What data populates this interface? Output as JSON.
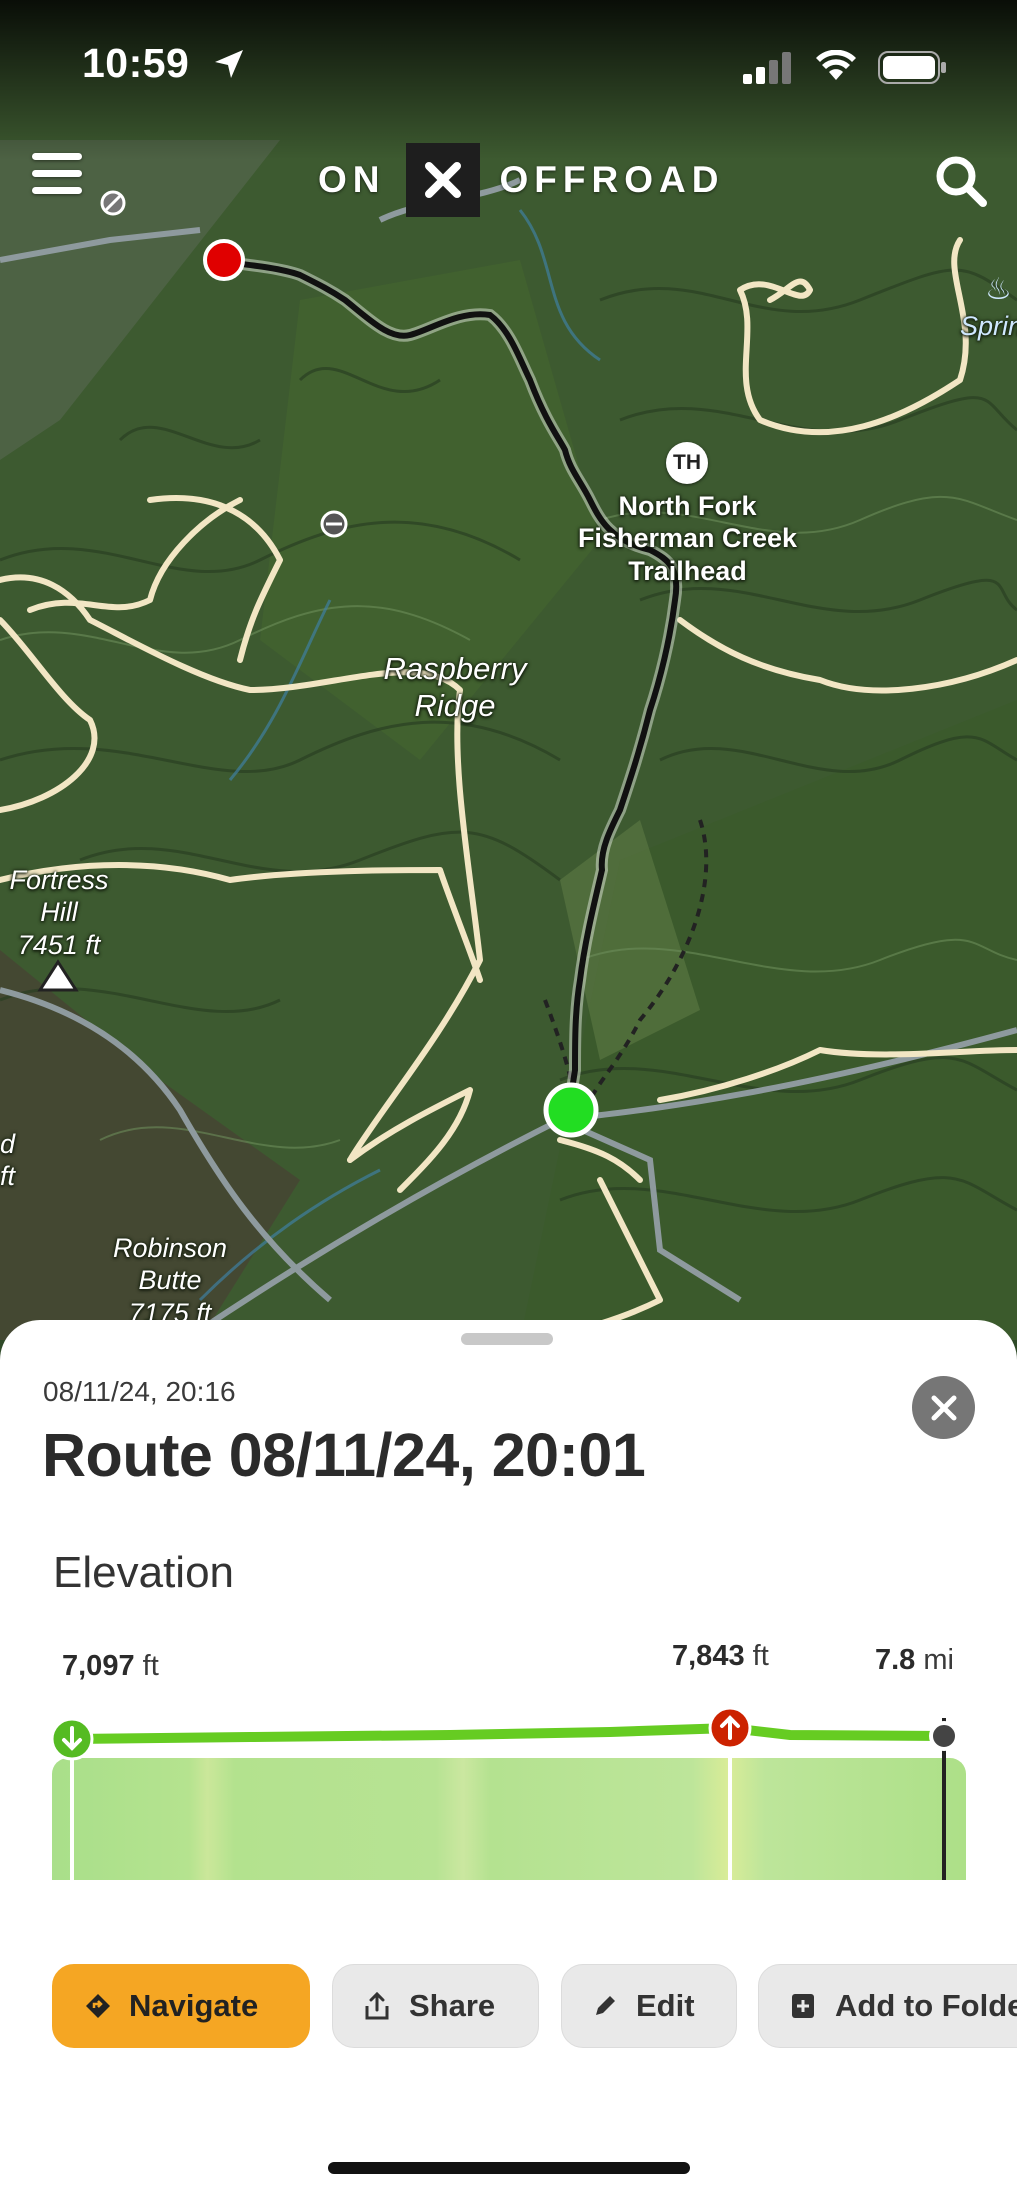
{
  "status_bar": {
    "time": "10:59",
    "icons": [
      "location-arrow-icon",
      "cellular-signal-icon",
      "wifi-icon",
      "battery-icon"
    ]
  },
  "header": {
    "logo_left": "ON",
    "logo_mark": "✕",
    "logo_right": "OFFROAD",
    "menu_icon": "hamburger-menu-icon",
    "search_icon": "search-icon"
  },
  "map": {
    "labels": {
      "trailhead_badge": "TH",
      "trailhead_name_1": "North Fork",
      "trailhead_name_2": "Fisherman Creek",
      "trailhead_name_3": "Trailhead",
      "ridge_1": "Raspberry",
      "ridge_2": "Ridge",
      "fortress_1": "Fortress",
      "fortress_2": "Hill",
      "fortress_elev": "7451 ft",
      "robinson_1": "Robinson",
      "robinson_2": "Butte",
      "robinson_elev": "7175 ft",
      "edge_right": "Sprin",
      "edge_left_1": "d",
      "edge_left_2": "ft"
    },
    "colors": {
      "terrain": "#3d5a30",
      "route_line": "#111111",
      "start_marker": "#e00000",
      "end_marker": "#22dd22",
      "trails": "#f2e6c4"
    }
  },
  "sheet": {
    "date": "08/11/24, 20:16",
    "title": "Route 08/11/24, 20:01",
    "close_icon": "close-icon",
    "elevation": {
      "heading": "Elevation",
      "min_value": "7,097",
      "min_unit": "ft",
      "max_value": "7,843",
      "max_unit": "ft",
      "distance_value": "7.8",
      "distance_unit": "mi",
      "colors": {
        "line": "#66cc22",
        "fill": "#b6e59a",
        "low_marker": "#55bb22",
        "high_marker": "#cc2200"
      }
    },
    "actions": {
      "navigate": "Navigate",
      "share": "Share",
      "edit": "Edit",
      "add_to_folder": "Add to Folder",
      "colors": {
        "navigate": "#f5a623"
      }
    }
  }
}
